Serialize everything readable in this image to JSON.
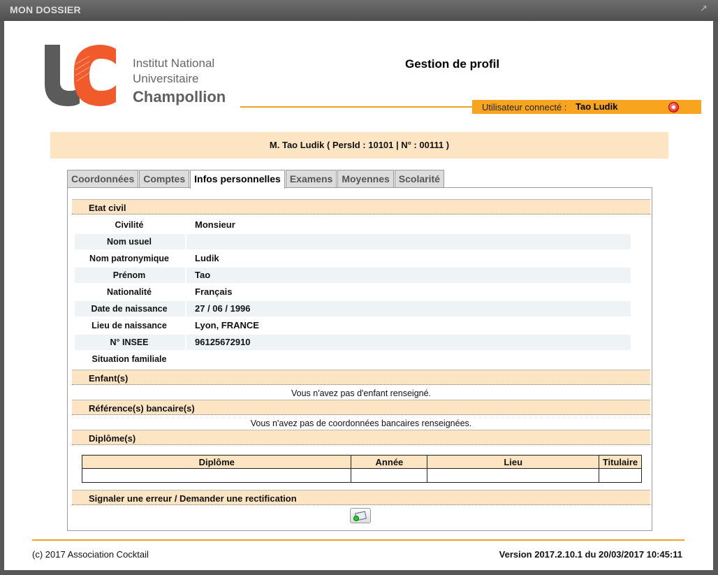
{
  "window": {
    "title": "MON DOSSIER"
  },
  "header": {
    "logo": {
      "line1": "Institut National",
      "line2": "Universitaire",
      "line3": "Champollion"
    },
    "page_title": "Gestion de profil",
    "user_label": "Utilisateur connecté :",
    "user_name": "Tao Ludik"
  },
  "identity": "M. Tao Ludik ( PersId : 10101 | N° : 00111 )",
  "tabs": [
    {
      "label": "Coordonnées",
      "active": false
    },
    {
      "label": "Comptes",
      "active": false
    },
    {
      "label": "Infos personnelles",
      "active": true
    },
    {
      "label": "Examens",
      "active": false
    },
    {
      "label": "Moyennes",
      "active": false
    },
    {
      "label": "Scolarité",
      "active": false
    }
  ],
  "etat_civil": {
    "heading": "Etat civil",
    "rows": [
      {
        "label": "Civilité",
        "value": "Monsieur"
      },
      {
        "label": "Nom usuel",
        "value": ""
      },
      {
        "label": "Nom patronymique",
        "value": "Ludik"
      },
      {
        "label": "Prénom",
        "value": "Tao"
      },
      {
        "label": "Nationalité",
        "value": "Français"
      },
      {
        "label": "Date de naissance",
        "value": "27 / 06 / 1996"
      },
      {
        "label": "Lieu de naissance",
        "value": "Lyon, FRANCE"
      },
      {
        "label": "N° INSEE",
        "value": "96125672910"
      },
      {
        "label": "Situation familiale",
        "value": ""
      }
    ]
  },
  "enfants": {
    "heading": "Enfant(s)",
    "message": "Vous n'avez pas d'enfant renseigné."
  },
  "banque": {
    "heading": "Référence(s) bancaire(s)",
    "message": "Vous n'avez pas de coordonnées bancaires renseignées."
  },
  "diplomes": {
    "heading": "Diplôme(s)",
    "columns": [
      "Diplôme",
      "Année",
      "Lieu",
      "Titulaire"
    ]
  },
  "signaler": {
    "heading": "Signaler une erreur / Demander une rectification"
  },
  "footer": {
    "copyright": "(c) 2017 Association Cocktail",
    "version": "Version 2017.2.10.1 du 20/03/2017 10:45:11"
  },
  "colors": {
    "accent": "#f7a51e",
    "section_bg": "#fde5c4",
    "logo_grey": "#5b5b5b",
    "logo_orange": "#f15a2b"
  }
}
